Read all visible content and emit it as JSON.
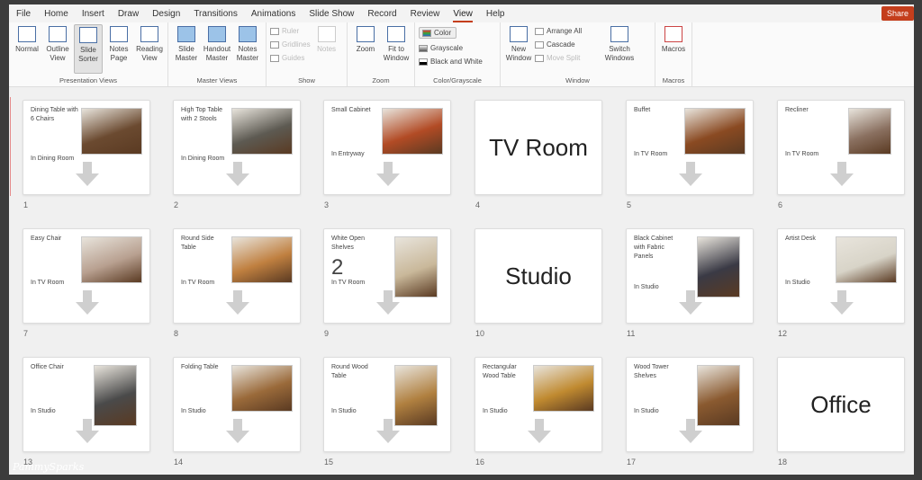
{
  "menu": [
    "File",
    "Home",
    "Insert",
    "Draw",
    "Design",
    "Transitions",
    "Animations",
    "Slide Show",
    "Record",
    "Review",
    "View",
    "Help"
  ],
  "active_menu": "View",
  "share_label": "Share",
  "ribbon": {
    "presentation_views": {
      "label": "Presentation Views",
      "items": [
        "Normal",
        "Outline View",
        "Slide Sorter",
        "Notes Page",
        "Reading View"
      ],
      "selected": "Slide Sorter"
    },
    "master_views": {
      "label": "Master Views",
      "items": [
        "Slide Master",
        "Handout Master",
        "Notes Master"
      ]
    },
    "show": {
      "label": "Show",
      "checks": [
        "Ruler",
        "Gridlines",
        "Guides"
      ],
      "notes": "Notes"
    },
    "zoom": {
      "label": "Zoom",
      "items": [
        "Zoom",
        "Fit to Window"
      ]
    },
    "color": {
      "label": "Color/Grayscale",
      "items": [
        "Color",
        "Grayscale",
        "Black and White"
      ]
    },
    "window": {
      "label": "Window",
      "new_window": "New Window",
      "items": [
        "Arrange All",
        "Cascade",
        "Move Split"
      ],
      "switch": "Switch Windows"
    },
    "macros": {
      "label": "Macros",
      "item": "Macros"
    }
  },
  "slides": [
    {
      "num": "1",
      "title": "Dining Table with 6 Chairs",
      "loc": "In Dining Room",
      "photo": "#6b4a30"
    },
    {
      "num": "2",
      "title": "High Top Table with 2 Stools",
      "loc": "In Dining Room",
      "photo": "#5d5a52"
    },
    {
      "num": "3",
      "title": "Small Cabinet",
      "loc": "In Entryway",
      "photo": "#b24b25"
    },
    {
      "num": "4",
      "big": "TV Room"
    },
    {
      "num": "5",
      "title": "Buffet",
      "loc": "In TV Room",
      "photo": "#8a4a22"
    },
    {
      "num": "6",
      "title": "Recliner",
      "loc": "In TV Room",
      "photo": "#8a7060"
    },
    {
      "num": "7",
      "title": "Easy Chair",
      "loc": "In TV Room",
      "photo": "#b8a090"
    },
    {
      "num": "8",
      "title": "Round Side Table",
      "loc": "In TV Room",
      "photo": "#c08040"
    },
    {
      "num": "9",
      "title": "White Open Shelves",
      "extra": "2",
      "loc": "In TV Room",
      "photo": "#c9b89a"
    },
    {
      "num": "10",
      "big": "Studio"
    },
    {
      "num": "11",
      "title": "Black Cabinet with Fabric Panels",
      "loc": "In Studio",
      "photo": "#3a3a45"
    },
    {
      "num": "12",
      "title": "Artist Desk",
      "loc": "In Studio",
      "photo": "#d8d4c8"
    },
    {
      "num": "13",
      "title": "Office Chair",
      "loc": "In Studio",
      "photo": "#4a4a4a"
    },
    {
      "num": "14",
      "title": "Folding Table",
      "loc": "In Studio",
      "photo": "#9a6a3a"
    },
    {
      "num": "15",
      "title": "Round Wood Table",
      "loc": "In Studio",
      "photo": "#b08040"
    },
    {
      "num": "16",
      "title": "Rectangular Wood Table",
      "loc": "In Studio",
      "photo": "#c08a30"
    },
    {
      "num": "17",
      "title": "Wood Tower Shelves",
      "loc": "In Studio",
      "photo": "#8a5a30"
    },
    {
      "num": "18",
      "big": "Office"
    }
  ],
  "watermark": "PammySparks"
}
